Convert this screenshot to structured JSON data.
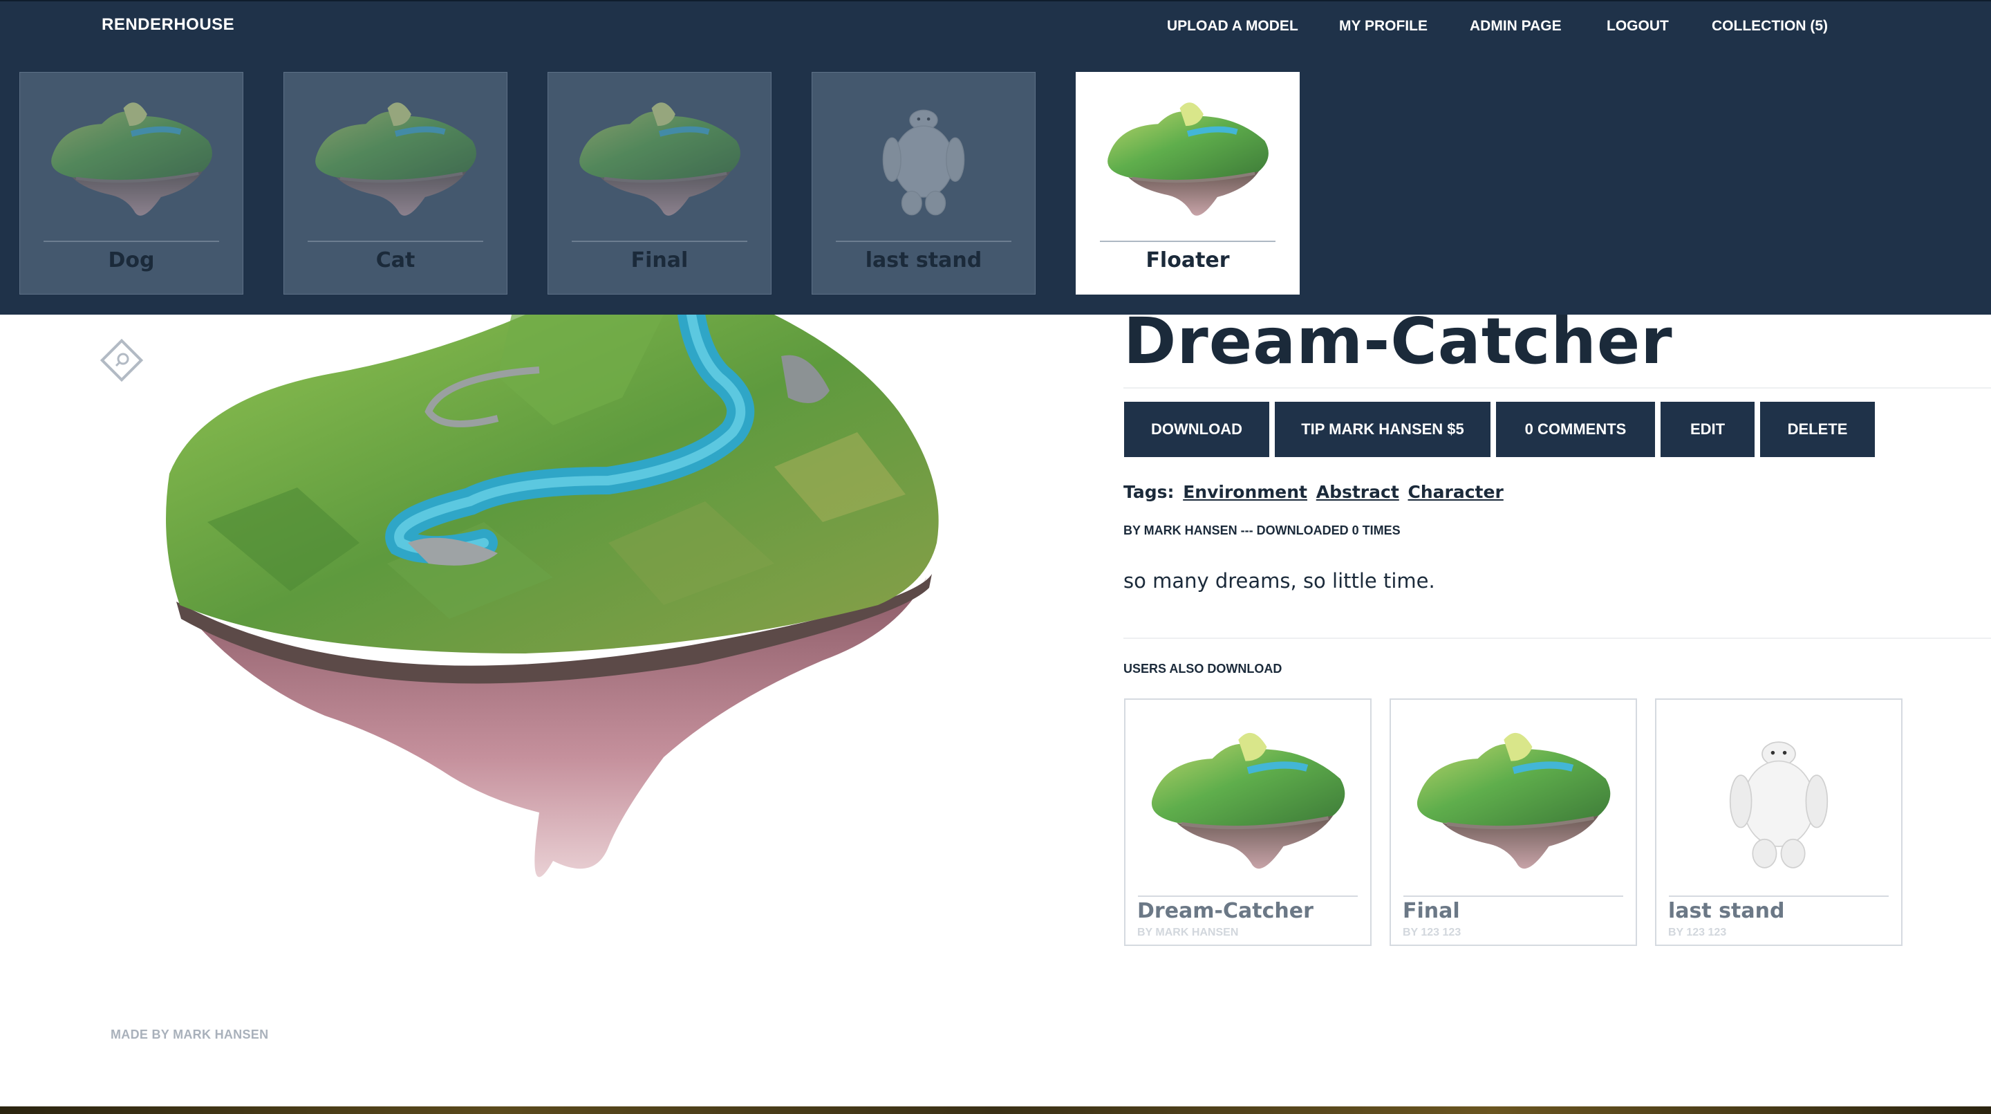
{
  "header": {
    "brand": "RENDERHOUSE",
    "nav": {
      "upload": "UPLOAD A MODEL",
      "profile": "MY PROFILE",
      "admin": "ADMIN PAGE",
      "logout": "LOGOUT",
      "collection": "COLLECTION (5)"
    }
  },
  "collection": {
    "items": [
      {
        "label": "Dog",
        "icon": "floating-island-thumbnail"
      },
      {
        "label": "Cat",
        "icon": "floating-island-thumbnail"
      },
      {
        "label": "Final",
        "icon": "floating-island-thumbnail"
      },
      {
        "label": "last stand",
        "icon": "robot-figure-thumbnail"
      },
      {
        "label": "Floater",
        "icon": "floating-island-thumbnail",
        "selected": true
      }
    ]
  },
  "viewer": {
    "model_icon": "floating-island-3d-model",
    "zoom_icon": "zoom-icon",
    "made_by": "MADE BY MARK HANSEN"
  },
  "model": {
    "title": "Dream-Catcher",
    "buttons": {
      "download": "DOWNLOAD",
      "tip": "TIP MARK HANSEN $5",
      "comments": "0 COMMENTS",
      "edit": "EDIT",
      "delete": "DELETE"
    },
    "tags_label": "Tags:",
    "tags": [
      "Environment",
      "Abstract",
      "Character"
    ],
    "byline": "BY MARK HANSEN --- DOWNLOADED 0 TIMES",
    "description": "so many dreams, so little time."
  },
  "also_download": {
    "heading": "USERS ALSO DOWNLOAD",
    "items": [
      {
        "name": "Dream-Catcher",
        "by": "BY MARK HANSEN",
        "icon": "floating-island-thumbnail"
      },
      {
        "name": "Final",
        "by": "BY 123 123",
        "icon": "floating-island-thumbnail"
      },
      {
        "name": "last stand",
        "by": "BY 123 123",
        "icon": "robot-figure-thumbnail"
      }
    ]
  },
  "colors": {
    "navy": "#1f3249",
    "card_muted": "#44586e",
    "text_dark": "#1b2a3a",
    "muted_text": "#a9b1bb"
  }
}
